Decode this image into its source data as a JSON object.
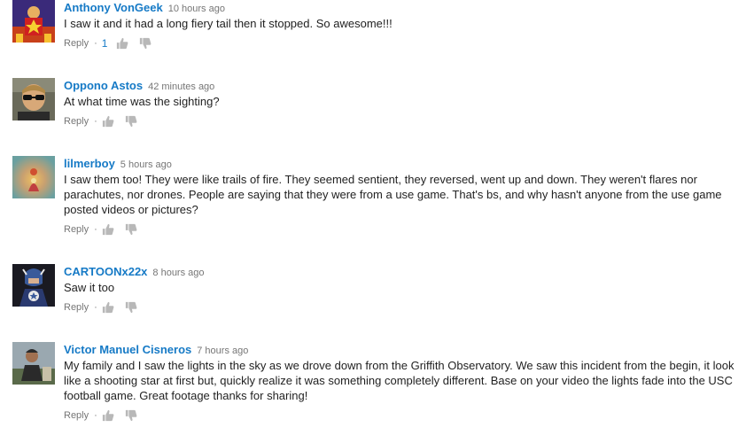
{
  "comments": [
    {
      "author": "Anthony VonGeek",
      "time": "10 hours ago",
      "text": "I saw it and it had a long fiery tail then it stopped. So awesome!!!",
      "reply_label": "Reply",
      "separator": "·",
      "likes": "1"
    },
    {
      "author": "Oppono Astos",
      "time": "42 minutes ago",
      "text": "At what time was the sighting?",
      "reply_label": "Reply",
      "separator": "·"
    },
    {
      "author": "lilmerboy",
      "time": "5 hours ago",
      "text": "I saw them too! They were like trails of fire. They seemed sentient, they reversed, went up and down. They weren't flares nor parachutes, nor drones. People are saying that they were from a use game. That's bs, and why hasn't anyone from the use game posted videos or pictures?",
      "reply_label": "Reply",
      "separator": "·"
    },
    {
      "author": "CARTOONx22x",
      "time": "8 hours ago",
      "text": "Saw it too",
      "reply_label": "Reply",
      "separator": "·"
    },
    {
      "author": "Victor Manuel Cisneros",
      "time": "7 hours ago",
      "text": "My family and I saw the lights in the sky as we drove down from the Griffith Observatory. We saw this incident from the begin, it look like a shooting star at first but, quickly realize it was something completely different. Base on your video the lights fade into the USC football game. Great footage thanks for sharing!",
      "reply_label": "Reply",
      "separator": "·"
    }
  ],
  "colors": {
    "author_link": "#167ac6",
    "meta_gray": "#767676",
    "body_text": "#222222",
    "thumb_icon": "#b8b8b8"
  },
  "icons": {
    "like": "thumbs-up-icon",
    "dislike": "thumbs-down-icon"
  }
}
